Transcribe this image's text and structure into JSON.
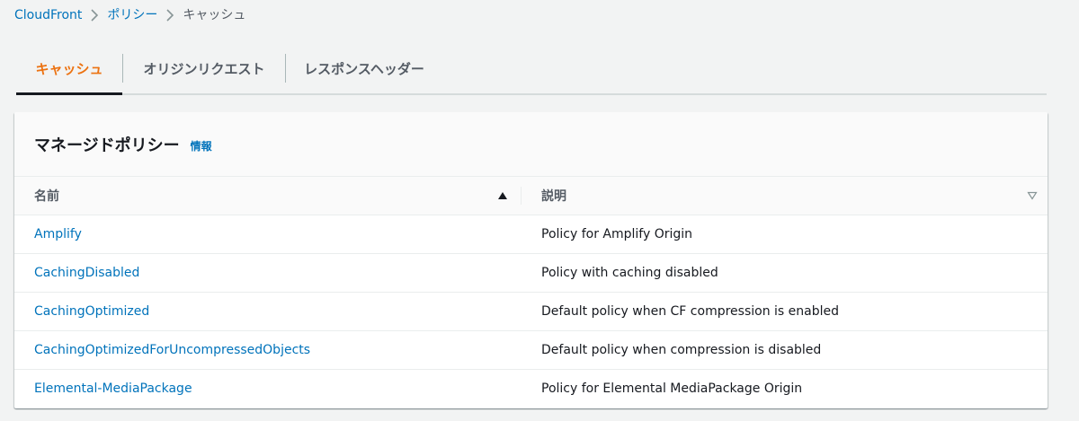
{
  "breadcrumb": {
    "items": [
      {
        "label": "CloudFront"
      },
      {
        "label": "ポリシー"
      },
      {
        "label": "キャッシュ"
      }
    ]
  },
  "tabs": [
    {
      "label": "キャッシュ",
      "active": true
    },
    {
      "label": "オリジンリクエスト",
      "active": false
    },
    {
      "label": "レスポンスヘッダー",
      "active": false
    }
  ],
  "container": {
    "title": "マネージドポリシー",
    "info_label": "情報"
  },
  "table": {
    "columns": [
      {
        "label": "名前",
        "sort": "ascending"
      },
      {
        "label": "説明",
        "sort": "none"
      }
    ],
    "rows": [
      {
        "name": "Amplify",
        "description": "Policy for Amplify Origin"
      },
      {
        "name": "CachingDisabled",
        "description": "Policy with caching disabled"
      },
      {
        "name": "CachingOptimized",
        "description": "Default policy when CF compression is enabled"
      },
      {
        "name": "CachingOptimizedForUncompressedObjects",
        "description": "Default policy when compression is disabled"
      },
      {
        "name": "Elemental-MediaPackage",
        "description": "Policy for Elemental MediaPackage Origin"
      }
    ]
  },
  "colors": {
    "link": "#0073bb",
    "active_tab": "#ec7211",
    "text": "#16191f",
    "muted": "#545b64",
    "background": "#f2f3f3"
  }
}
